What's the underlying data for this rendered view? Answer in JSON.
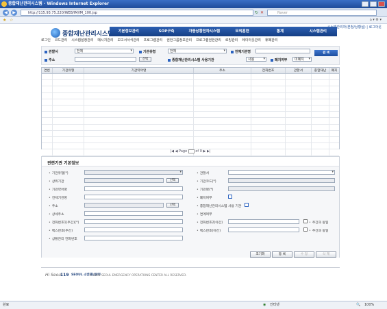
{
  "window": {
    "title": "종합재난관리시스템 - Windows Internet Explorer",
    "url": "http://115.93.75.220/WEB/IM/IM_100.jsp",
    "search_placeholder": "Naver",
    "status_left": "완료",
    "status_zone": "인터넷",
    "zoom": "100%"
  },
  "header": {
    "top_links": [
      "시스템관리자(본청/상황실)",
      "로그아웃"
    ],
    "logo": "종합재난관리시스템"
  },
  "main_nav": [
    "기본정보관리",
    "SOP구축",
    "자동상황전파시스템",
    "모의훈련",
    "통계",
    "시스템관리"
  ],
  "sub_nav": [
    "로그인",
    "코드관리",
    "시스템설정관리",
    "메시지관리",
    "보고서서식관리",
    "프로그램관리",
    "권한그룹정보관리",
    "프로그램권한관리",
    "로밍관리",
    "레이아웃관리",
    "휴폐관리"
  ],
  "search": {
    "area_label": "관할서",
    "area_value": "전체",
    "org_type_label": "기관유형",
    "org_type_value": "전체",
    "org_name_label": "전체기관명",
    "org_name_value": "",
    "address_label": "주소",
    "address_value": "",
    "address_button": "선택",
    "usage_label": "종합재난관리시스템 사용기관",
    "usage_value": "사용",
    "closed_label": "폐지여부",
    "closed_value": "미폐지",
    "search_button": "검 색"
  },
  "grid": {
    "columns": [
      "연번",
      "기관유형",
      "기관약어명",
      "주소",
      "전화번호",
      "관할서",
      "종합재난",
      "폐지"
    ],
    "rows": 18
  },
  "pager": {
    "text_prefix": "Page",
    "page": "0",
    "text_suffix": "of 0"
  },
  "detail": {
    "title": "관련기관 기본정보",
    "left_fields": [
      "기관유형(*)",
      "상위기관",
      "기관약어명",
      "전체기관명",
      "주소",
      "상세주소",
      "전화번호1(주간)(*)",
      "팩스번호(주간)",
      "상황관리 전화번호"
    ],
    "right_fields": [
      "관할서",
      "기관코드(*)",
      "기관명(*)",
      "폐지여부",
      "종합재난관리시스템 사용 기관",
      "연계여부",
      "전화번호2(야간)",
      "팩스번호(야간)"
    ],
    "select_button": "선택",
    "checkbox_label_1": "주간과 동일",
    "checkbox_label_2": "주간과 동일",
    "buttons": [
      "초기화",
      "등 록",
      "수 정",
      "삭 제"
    ]
  },
  "footer": {
    "logo_left": "Hi Seoul",
    "logo_mid": "119",
    "logo_right": "SEOUL 소방재난본부",
    "copyright": "© 2008 SEOUL EMERGENCY OPERATIONS CENTER ALL RESERVED."
  }
}
